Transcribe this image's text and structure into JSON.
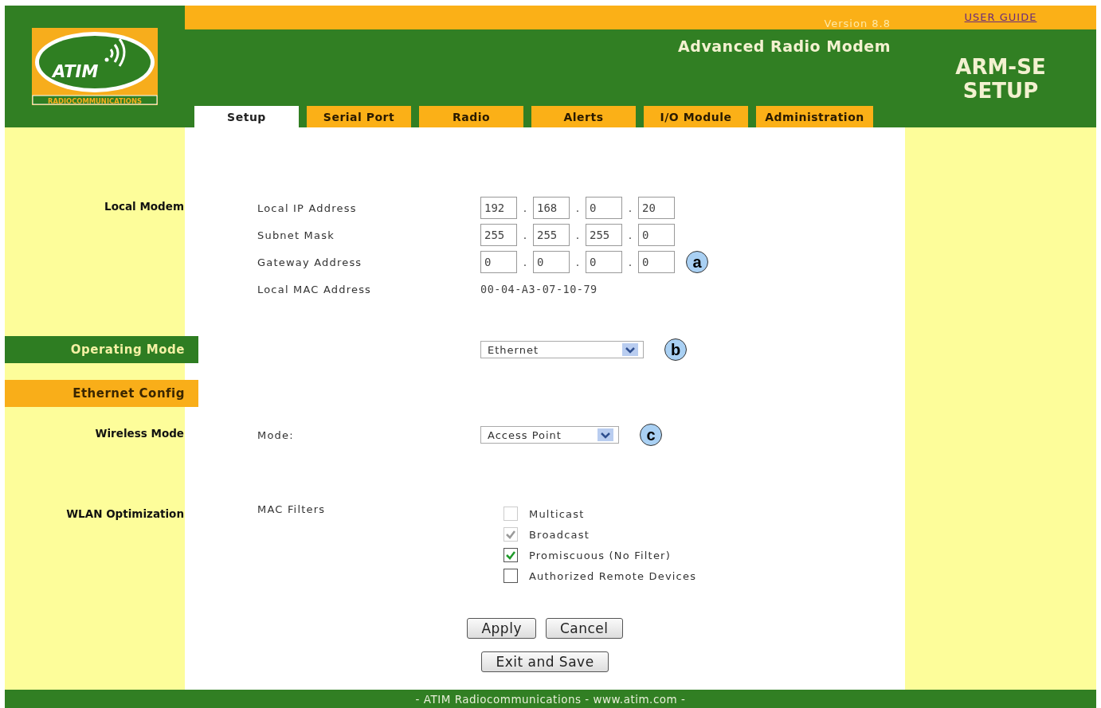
{
  "header": {
    "logo": {
      "name": "ATIM",
      "tagline": "RADIOCOMMUNICATIONS"
    },
    "version": "Version 8.8",
    "user_guide": "USER GUIDE",
    "product": "Advanced Radio Modem",
    "page_title": [
      "ARM-SE",
      "SETUP"
    ]
  },
  "tabs": [
    {
      "label": "Setup",
      "selected": true
    },
    {
      "label": "Serial Port",
      "selected": false
    },
    {
      "label": "Radio",
      "selected": false
    },
    {
      "label": "Alerts",
      "selected": false
    },
    {
      "label": "I/O Module",
      "selected": false
    },
    {
      "label": "Administration",
      "selected": false
    }
  ],
  "sections": [
    {
      "label": "Local Modem",
      "kind": "heading",
      "fields": [
        {
          "label": "Local IP Address",
          "kind": "ip",
          "separator": ".",
          "octets": [
            "192",
            "168",
            "0",
            "20"
          ]
        },
        {
          "label": "Subnet Mask",
          "kind": "ip",
          "separator": ".",
          "octets": [
            "255",
            "255",
            "255",
            "0"
          ]
        },
        {
          "label": "Gateway Address",
          "kind": "ip",
          "separator": ".",
          "octets": [
            "0",
            "0",
            "0",
            "0"
          ],
          "callout": "a"
        },
        {
          "label": "Local MAC Address",
          "kind": "text",
          "value": "00-04-A3-07-10-79"
        }
      ]
    },
    {
      "label": "Operating Mode",
      "kind": "banner",
      "color": "#2e7d22",
      "fields": [
        {
          "kind": "select",
          "value": "Ethernet",
          "callout": "b"
        }
      ]
    },
    {
      "label": "Ethernet Config",
      "kind": "banner",
      "color": "#f9ae19"
    },
    {
      "label": "Wireless Mode",
      "kind": "heading",
      "fields": [
        {
          "label": "Mode:",
          "kind": "select",
          "value": "Access Point",
          "callout": "c"
        }
      ]
    },
    {
      "label": "WLAN Optimization",
      "kind": "heading",
      "fields": [
        {
          "label": "MAC Filters",
          "kind": "checkboxes",
          "options": [
            {
              "label": "Multicast",
              "checked": false,
              "disabled": true
            },
            {
              "label": "Broadcast",
              "checked": true,
              "disabled": true
            },
            {
              "label": "Promiscuous (No Filter)",
              "checked": true,
              "disabled": false
            },
            {
              "label": "Authorized Remote Devices",
              "checked": false,
              "disabled": false
            }
          ]
        }
      ]
    }
  ],
  "buttons": [
    [
      "Apply",
      "Cancel"
    ],
    [
      "Exit and Save"
    ]
  ],
  "footer": "- ATIM Radiocommunications - www.atim.com -"
}
